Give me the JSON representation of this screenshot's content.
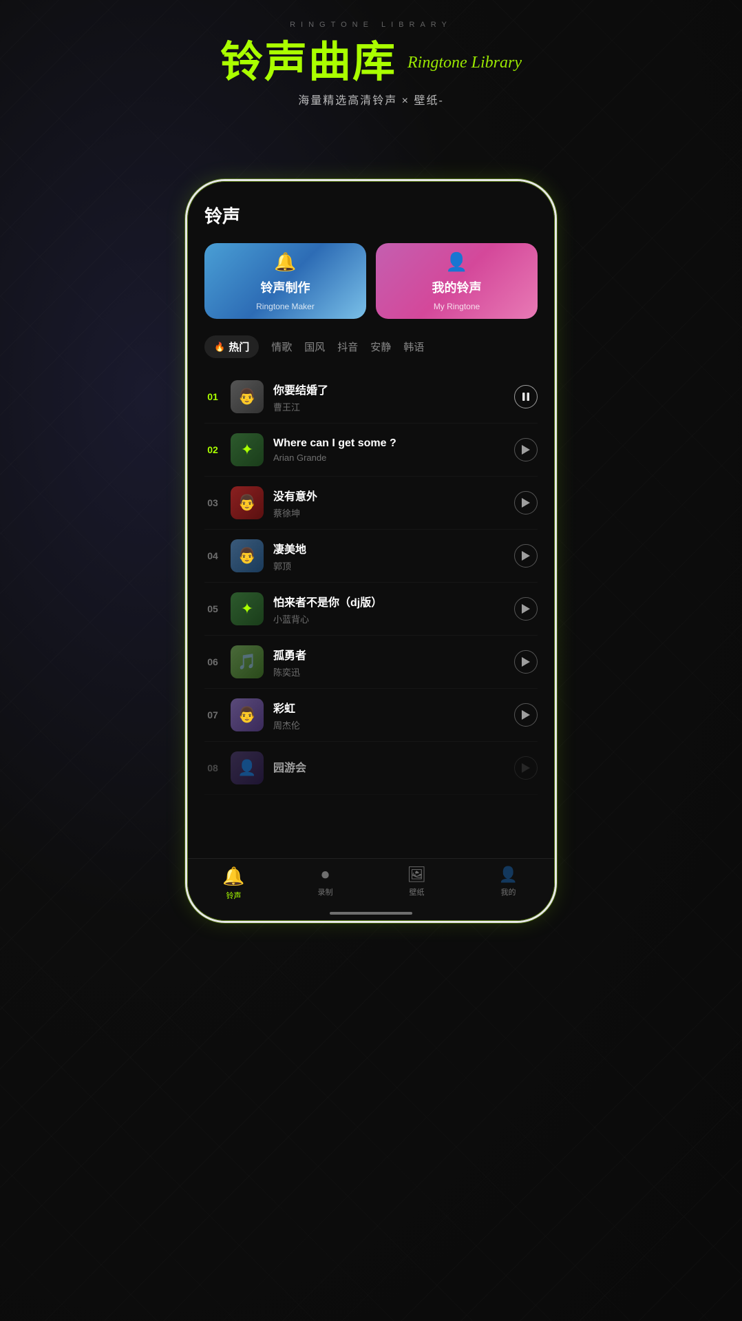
{
  "page": {
    "bg_text": "RINGTONE LIBRARY",
    "title_cn": "铃声曲库",
    "title_en": "Ringtone Library",
    "subtitle": "海量精选高清铃声 × 壁纸-"
  },
  "cards": [
    {
      "id": "ringtone-maker",
      "icon": "🔔",
      "title_cn": "铃声制作",
      "title_en": "Ringtone Maker"
    },
    {
      "id": "my-ringtone",
      "icon": "👤",
      "title_cn": "我的铃声",
      "title_en": "My Ringtone"
    }
  ],
  "tabs": [
    {
      "id": "hot",
      "label": "热门",
      "active": true
    },
    {
      "id": "love",
      "label": "情歌",
      "active": false
    },
    {
      "id": "chinese",
      "label": "国风",
      "active": false
    },
    {
      "id": "douyin",
      "label": "抖音",
      "active": false
    },
    {
      "id": "quiet",
      "label": "安静",
      "active": false
    },
    {
      "id": "korean",
      "label": "韩语",
      "active": false
    }
  ],
  "songs": [
    {
      "number": "01",
      "name": "你要结婚了",
      "artist": "曹王江",
      "playing": true,
      "highlight": true
    },
    {
      "number": "02",
      "name": "Where can I get some ?",
      "artist": "Arian Grande",
      "playing": false,
      "highlight": true
    },
    {
      "number": "03",
      "name": "没有意外",
      "artist": "蔡徐坤",
      "playing": false,
      "highlight": false
    },
    {
      "number": "04",
      "name": "凄美地",
      "artist": "郭顶",
      "playing": false,
      "highlight": false
    },
    {
      "number": "05",
      "name": "怕来者不是你（dj版）",
      "artist": "小蓝背心",
      "playing": false,
      "highlight": false
    },
    {
      "number": "06",
      "name": "孤勇者",
      "artist": "陈奕迅",
      "playing": false,
      "highlight": false
    },
    {
      "number": "07",
      "name": "彩虹",
      "artist": "周杰伦",
      "playing": false,
      "highlight": false
    },
    {
      "number": "08",
      "name": "园游会",
      "artist": "",
      "playing": false,
      "highlight": false,
      "partial": true
    }
  ],
  "nav": [
    {
      "id": "ringtone",
      "icon": "🔔",
      "label": "铃声",
      "active": true
    },
    {
      "id": "record",
      "icon": "⏺",
      "label": "录制",
      "active": false
    },
    {
      "id": "wallpaper",
      "icon": "🖼",
      "label": "壁纸",
      "active": false
    },
    {
      "id": "mine",
      "icon": "👤",
      "label": "我的",
      "active": false
    }
  ]
}
